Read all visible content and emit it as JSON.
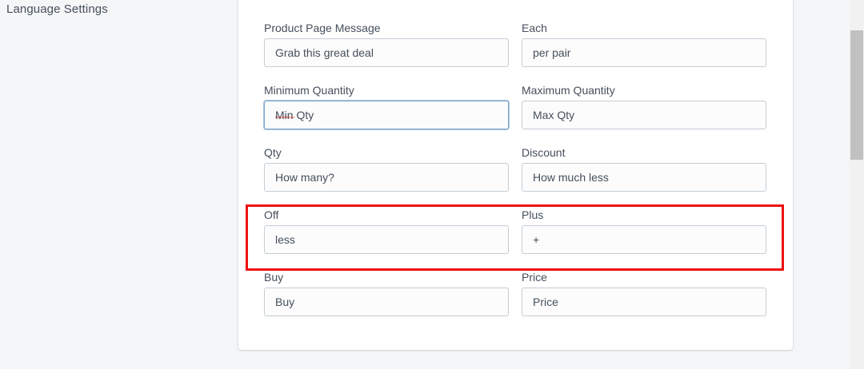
{
  "section": {
    "title": "Language Settings"
  },
  "fields": {
    "product_page_message": {
      "label": "Product Page Message",
      "value": "Grab this great deal"
    },
    "each": {
      "label": "Each",
      "value": "per pair"
    },
    "minimum_quantity": {
      "label": "Minimum Quantity",
      "value": "Min Qty"
    },
    "maximum_quantity": {
      "label": "Maximum Quantity",
      "value": "Max Qty"
    },
    "qty": {
      "label": "Qty",
      "value": "How many?"
    },
    "discount": {
      "label": "Discount",
      "value": "How much less"
    },
    "off": {
      "label": "Off",
      "value": "less"
    },
    "plus": {
      "label": "Plus",
      "value": "+"
    },
    "buy": {
      "label": "Buy",
      "value": "Buy"
    },
    "price": {
      "label": "Price",
      "value": "Price"
    }
  },
  "colors": {
    "highlight": "#ee1111",
    "focus_border": "#7fa6c9"
  }
}
